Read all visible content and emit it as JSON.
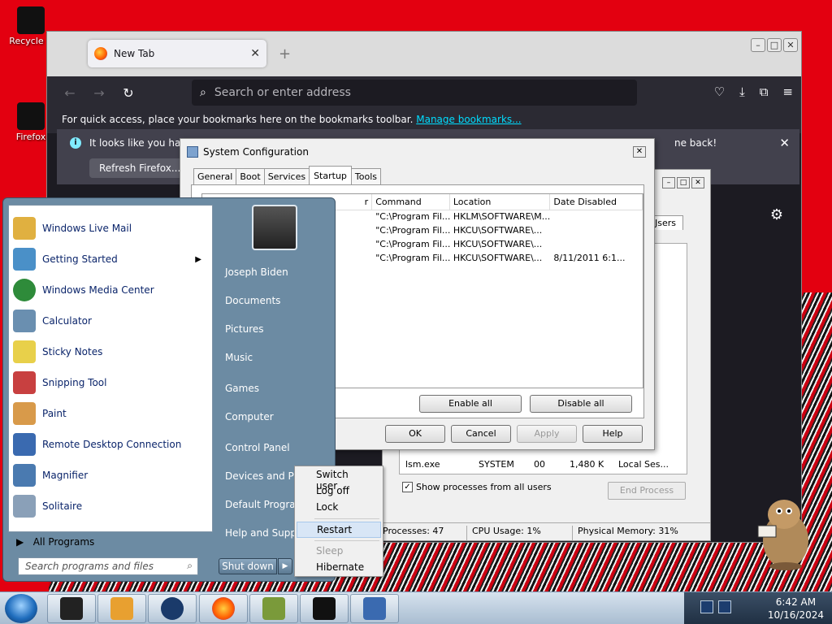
{
  "desktop": {
    "icons": [
      {
        "label": "Recycle B"
      },
      {
        "label": "Firefox"
      }
    ]
  },
  "firefox": {
    "tab_title": "New Tab",
    "address_placeholder": "Search or enter address",
    "bookmarks_message": "For quick access, place your bookmarks here on the bookmarks toolbar.",
    "manage_bookmarks": "Manage bookmarks...",
    "notice_text": "It looks like you have",
    "notice_text_end": "ne back!",
    "refresh_button": "Refresh Firefox..."
  },
  "sysconfig": {
    "title": "System Configuration",
    "tabs": [
      "General",
      "Boot",
      "Services",
      "Startup",
      "Tools"
    ],
    "active_tab": "Startup",
    "columns": [
      "r",
      "Command",
      "Location",
      "Date Disabled"
    ],
    "rows": [
      {
        "command": "\"C:\\Program Fil...",
        "location": "HKLM\\SOFTWARE\\M...",
        "date": ""
      },
      {
        "command": "\"C:\\Program Fil...",
        "location": "HKCU\\SOFTWARE\\...",
        "date": ""
      },
      {
        "command": "\"C:\\Program Fil...",
        "location": "HKCU\\SOFTWARE\\...",
        "date": ""
      },
      {
        "command": "\"C:\\Program Fil...",
        "location": "HKCU\\SOFTWARE\\...",
        "date": "8/11/2011 6:1..."
      }
    ],
    "enable_all": "Enable all",
    "disable_all": "Disable all",
    "ok": "OK",
    "cancel": "Cancel",
    "apply": "Apply",
    "help": "Help"
  },
  "taskmgr": {
    "tab_label": "Jsers",
    "row": {
      "name": "lsm.exe",
      "user": "SYSTEM",
      "cpu": "00",
      "mem": "1,480 K",
      "desc": "Local Ses..."
    },
    "show_all_label": "Show processes from all users",
    "end_process": "End Process",
    "status": {
      "processes": "Processes: 47",
      "cpu": "CPU Usage: 1%",
      "memory": "Physical Memory: 31%"
    }
  },
  "startmenu": {
    "programs": [
      {
        "label": "Windows Live Mail",
        "color": "#e0b040"
      },
      {
        "label": "Getting Started",
        "color": "#4a90c8"
      },
      {
        "label": "Windows Media Center",
        "color": "#2e8b3a"
      },
      {
        "label": "Calculator",
        "color": "#6a8fb0"
      },
      {
        "label": "Sticky Notes",
        "color": "#e8d04a"
      },
      {
        "label": "Snipping Tool",
        "color": "#c84040"
      },
      {
        "label": "Paint",
        "color": "#d89a4a"
      },
      {
        "label": "Remote Desktop Connection",
        "color": "#3a6ab0"
      },
      {
        "label": "Magnifier",
        "color": "#4a7ab0"
      },
      {
        "label": "Solitaire",
        "color": "#8aa0b8"
      }
    ],
    "all_programs": "All Programs",
    "search_placeholder": "Search programs and files",
    "right_items": [
      "Joseph Biden",
      "Documents",
      "Pictures",
      "Music",
      "Games",
      "Computer",
      "Control Panel",
      "Devices and Prin",
      "Default Program",
      "Help and Suppo"
    ],
    "shutdown": "Shut down"
  },
  "power_menu": {
    "items": [
      "Switch user",
      "Log off",
      "Lock",
      "Restart",
      "Sleep",
      "Hibernate"
    ]
  },
  "taskbar": {
    "time": "6:42 AM",
    "date": "10/16/2024"
  }
}
